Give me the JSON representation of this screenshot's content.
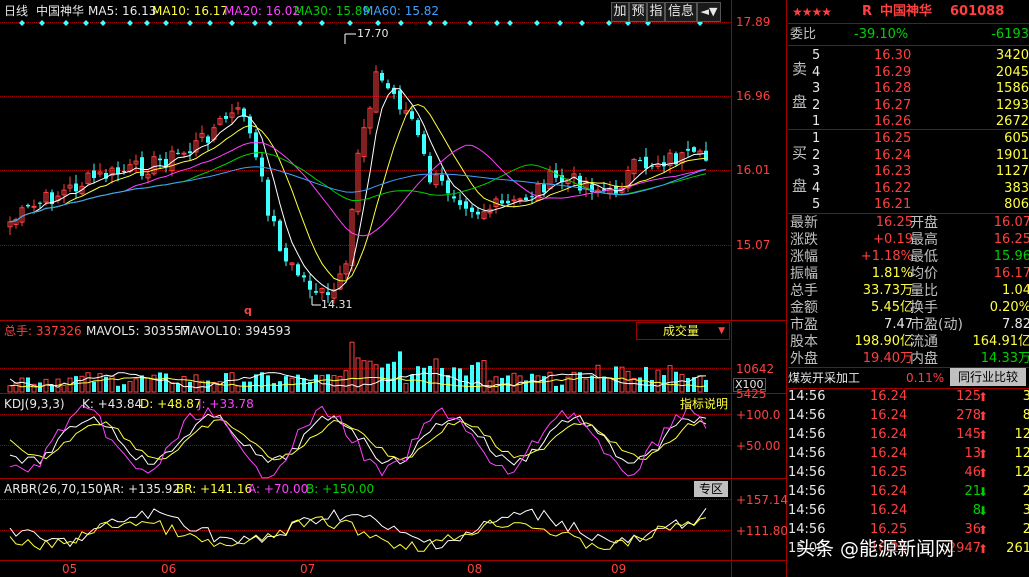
{
  "chart_header": {
    "period": "日线",
    "name": "中国神华",
    "ma5": "MA5: 16.13",
    "ma10": "MA10: 16.17",
    "ma20": "MA20: 16.02",
    "ma30": "MA30: 15.89",
    "ma60": "MA60: 15.82"
  },
  "toolbar": {
    "add": "加",
    "forecast": "预",
    "index": "指",
    "info": "信息",
    "more": "◄▼"
  },
  "price_axis": [
    "17.89",
    "16.96",
    "16.01",
    "15.07"
  ],
  "price_annotations": {
    "high": "17.70",
    "low": "14.31",
    "q": "q"
  },
  "volume_panel": {
    "label": "总手: 337326",
    "mavol5": "MAVOL5: 303557",
    "mavol10": "MAVOL10: 394593",
    "button": "成交量",
    "axis": [
      "10642",
      "5425"
    ],
    "unit": "X100"
  },
  "kdj_panel": {
    "label": "KDJ(9,3,3)",
    "k": "K: +43.84",
    "d": "D: +48.87",
    "j": "J: +33.78",
    "button": "指标说明",
    "axis": [
      "+100.0",
      "+50.00"
    ]
  },
  "arbr_panel": {
    "label": "ARBR(26,70,150)",
    "ar": "AR: +135.92",
    "br": "BR: +141.16",
    "a": "A: +70.00",
    "b": "B: +150.00",
    "button": "专区",
    "axis": [
      "+157.14",
      "+111.80"
    ]
  },
  "x_axis": [
    "05",
    "06",
    "07",
    "08",
    "09"
  ],
  "quote": {
    "stars": "★★★★",
    "r_mark": "R",
    "name": "中国神华",
    "code": "601088",
    "weibi_label": "委比",
    "weibi_pct": "-39.10%",
    "weibi_diff": "-6193",
    "sell_label_1": "卖",
    "sell_label_2": "盘",
    "buy_label_1": "买",
    "buy_label_2": "盘",
    "sell": [
      {
        "lvl": "5",
        "price": "16.30",
        "vol": "3420"
      },
      {
        "lvl": "4",
        "price": "16.29",
        "vol": "2045"
      },
      {
        "lvl": "3",
        "price": "16.28",
        "vol": "1586"
      },
      {
        "lvl": "2",
        "price": "16.27",
        "vol": "1293"
      },
      {
        "lvl": "1",
        "price": "16.26",
        "vol": "2672"
      }
    ],
    "buy": [
      {
        "lvl": "1",
        "price": "16.25",
        "vol": "605"
      },
      {
        "lvl": "2",
        "price": "16.24",
        "vol": "1901"
      },
      {
        "lvl": "3",
        "price": "16.23",
        "vol": "1127"
      },
      {
        "lvl": "4",
        "price": "16.22",
        "vol": "383"
      },
      {
        "lvl": "5",
        "price": "16.21",
        "vol": "806"
      }
    ],
    "stats": [
      {
        "l1": "最新",
        "v1": "16.25",
        "c1": "red",
        "l2": "开盘",
        "v2": "16.07",
        "c2": "red"
      },
      {
        "l1": "涨跌",
        "v1": "+0.19",
        "c1": "red",
        "l2": "最高",
        "v2": "16.25",
        "c2": "red"
      },
      {
        "l1": "涨幅",
        "v1": "+1.18%",
        "c1": "red",
        "l2": "最低",
        "v2": "15.96",
        "c2": "green"
      },
      {
        "l1": "振幅",
        "v1": "1.81%",
        "c1": "yellow",
        "l2": "均价",
        "v2": "16.17",
        "c2": "red"
      },
      {
        "l1": "总手",
        "v1": "33.73万",
        "c1": "yellow",
        "l2": "量比",
        "v2": "1.04",
        "c2": "yellow"
      },
      {
        "l1": "金额",
        "v1": "5.45亿",
        "c1": "yellow",
        "l2": "换手",
        "v2": "0.20%",
        "c2": "yellow"
      },
      {
        "l1": "市盈",
        "v1": "7.47",
        "c1": "white",
        "l2": "市盈(动)",
        "v2": "7.82",
        "c2": "white"
      },
      {
        "l1": "股本",
        "v1": "198.90亿",
        "c1": "yellow",
        "l2": "流通",
        "v2": "164.91亿",
        "c2": "yellow"
      },
      {
        "l1": "外盘",
        "v1": "19.40万",
        "c1": "red",
        "l2": "内盘",
        "v2": "14.33万",
        "c2": "green"
      }
    ],
    "sector": "煤炭开采加工",
    "sector_pct": "0.11%",
    "compare_button": "同行业比较",
    "ticks": [
      {
        "time": "14:56",
        "price": "16.24",
        "vol": "125",
        "dir": "up",
        "n": "3"
      },
      {
        "time": "14:56",
        "price": "16.24",
        "vol": "278",
        "dir": "up",
        "n": "8"
      },
      {
        "time": "14:56",
        "price": "16.24",
        "vol": "145",
        "dir": "up",
        "n": "12"
      },
      {
        "time": "14:56",
        "price": "16.24",
        "vol": "13",
        "dir": "up",
        "n": "12"
      },
      {
        "time": "14:56",
        "price": "16.25",
        "vol": "46",
        "dir": "up",
        "n": "12"
      },
      {
        "time": "14:56",
        "price": "16.24",
        "vol": "21",
        "dir": "down",
        "n": "2"
      },
      {
        "time": "14:56",
        "price": "16.24",
        "vol": "8",
        "dir": "down",
        "n": "3"
      },
      {
        "time": "14:56",
        "price": "16.25",
        "vol": "36",
        "dir": "up",
        "n": "2"
      },
      {
        "time": "15:00",
        "price": "16.25",
        "vol": "2947",
        "dir": "up",
        "n": "261"
      }
    ]
  },
  "watermark": "头条 @能源新闻网",
  "colors": {
    "up": "#ff4040",
    "down": "#40ffff",
    "grid": "#a00000",
    "ma5": "#ffffff",
    "ma10": "#ffff40",
    "ma20": "#ff40ff",
    "ma30": "#00d000",
    "ma60": "#40a0ff"
  }
}
